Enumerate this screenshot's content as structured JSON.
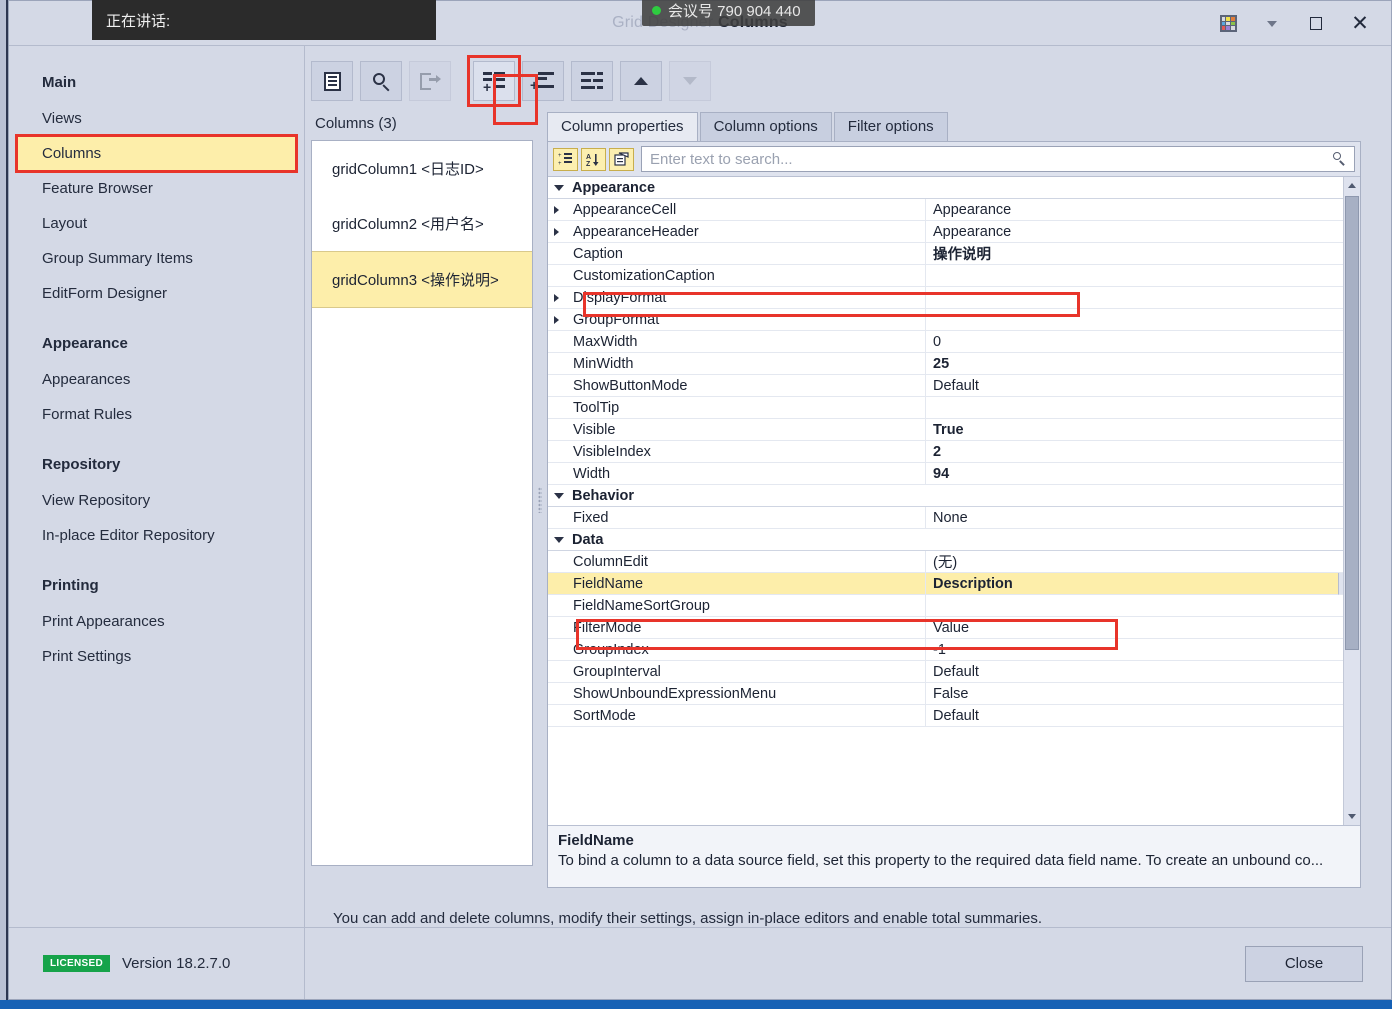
{
  "window": {
    "title_dim": "Grid Designer",
    "title_strong": "Columns",
    "buttons": {
      "grid_icon": "color-grid-icon",
      "dropdown_icon": "chevron-down-icon",
      "restore_label": "❐",
      "close_label": "✕"
    }
  },
  "overlays": {
    "speaking": "正在讲话:",
    "meeting": "会议号 790 904 440"
  },
  "sidebar": {
    "groups": [
      {
        "title": "Main",
        "items": [
          "Views",
          "Columns",
          "Feature Browser",
          "Layout",
          "Group Summary Items",
          "EditForm Designer"
        ]
      },
      {
        "title": "Appearance",
        "items": [
          "Appearances",
          "Format Rules"
        ]
      },
      {
        "title": "Repository",
        "items": [
          "View Repository",
          "In-place Editor Repository"
        ]
      },
      {
        "title": "Printing",
        "items": [
          "Print Appearances",
          "Print Settings"
        ]
      }
    ],
    "selected": "Columns",
    "footer": {
      "badge": "LICENSED",
      "version": "Version 18.2.7.0"
    }
  },
  "toolbar": {
    "buttons": [
      {
        "name": "show-designer-button",
        "icon": "document-icon",
        "disabled": false,
        "highlighted": false
      },
      {
        "name": "find-button",
        "icon": "search-icon",
        "disabled": false,
        "highlighted": false
      },
      {
        "name": "retrieve-fields-button",
        "icon": "export-icon",
        "disabled": true,
        "highlighted": false
      },
      {
        "name": "add-column-button",
        "icon": "add-list-item-icon",
        "disabled": false,
        "highlighted": true
      },
      {
        "name": "add-banded-column-button",
        "icon": "add-list-item-alt-icon",
        "disabled": false,
        "highlighted": false
      },
      {
        "name": "delete-column-button",
        "icon": "remove-list-item-icon",
        "disabled": false,
        "highlighted": false
      },
      {
        "name": "move-up-button",
        "icon": "chevron-up-icon",
        "disabled": false,
        "highlighted": false
      },
      {
        "name": "move-down-button",
        "icon": "chevron-down-icon",
        "disabled": true,
        "highlighted": false
      }
    ]
  },
  "columns_pane": {
    "title": "Columns (3)",
    "items": [
      {
        "label": "gridColumn1 <日志ID>",
        "selected": false
      },
      {
        "label": "gridColumn2 <用户名>",
        "selected": false
      },
      {
        "label": "gridColumn3 <操作说明>",
        "selected": true
      }
    ]
  },
  "property_pane": {
    "tabs": [
      {
        "label": "Column properties",
        "active": true
      },
      {
        "label": "Column options",
        "active": false
      },
      {
        "label": "Filter options",
        "active": false
      }
    ],
    "search": {
      "placeholder": "Enter text to search...",
      "value": "",
      "buttons": [
        {
          "name": "categorized-view-button",
          "glyph": "categorized-icon"
        },
        {
          "name": "alphabetical-sort-button",
          "glyph": "sort-az-icon"
        },
        {
          "name": "property-pages-button",
          "glyph": "property-pages-icon"
        }
      ]
    },
    "rows": [
      {
        "type": "category",
        "name": "Appearance"
      },
      {
        "type": "prop",
        "expandable": true,
        "name": "AppearanceCell",
        "value": "Appearance",
        "bold": false
      },
      {
        "type": "prop",
        "expandable": true,
        "name": "AppearanceHeader",
        "value": "Appearance",
        "bold": false
      },
      {
        "type": "prop",
        "expandable": false,
        "name": "Caption",
        "value": "操作说明",
        "bold": true
      },
      {
        "type": "prop",
        "expandable": false,
        "name": "CustomizationCaption",
        "value": "",
        "bold": false
      },
      {
        "type": "prop",
        "expandable": true,
        "name": "DisplayFormat",
        "value": "",
        "bold": false
      },
      {
        "type": "prop",
        "expandable": true,
        "name": "GroupFormat",
        "value": "",
        "bold": false
      },
      {
        "type": "prop",
        "expandable": false,
        "name": "MaxWidth",
        "value": "0",
        "bold": false
      },
      {
        "type": "prop",
        "expandable": false,
        "name": "MinWidth",
        "value": "25",
        "bold": true
      },
      {
        "type": "prop",
        "expandable": false,
        "name": "ShowButtonMode",
        "value": "Default",
        "bold": false
      },
      {
        "type": "prop",
        "expandable": false,
        "name": "ToolTip",
        "value": "",
        "bold": false
      },
      {
        "type": "prop",
        "expandable": false,
        "name": "Visible",
        "value": "True",
        "bold": true
      },
      {
        "type": "prop",
        "expandable": false,
        "name": "VisibleIndex",
        "value": "2",
        "bold": true
      },
      {
        "type": "prop",
        "expandable": false,
        "name": "Width",
        "value": "94",
        "bold": true
      },
      {
        "type": "category",
        "name": "Behavior"
      },
      {
        "type": "prop",
        "expandable": false,
        "name": "Fixed",
        "value": "None",
        "bold": false
      },
      {
        "type": "category",
        "name": "Data"
      },
      {
        "type": "prop",
        "expandable": false,
        "name": "ColumnEdit",
        "value": "(无)",
        "bold": false
      },
      {
        "type": "prop",
        "expandable": false,
        "name": "FieldName",
        "value": "Description",
        "bold": true,
        "selected": true,
        "dropdown": true
      },
      {
        "type": "prop",
        "expandable": false,
        "name": "FieldNameSortGroup",
        "value": "",
        "bold": false
      },
      {
        "type": "prop",
        "expandable": false,
        "name": "FilterMode",
        "value": "Value",
        "bold": false
      },
      {
        "type": "prop",
        "expandable": false,
        "name": "GroupIndex",
        "value": "-1",
        "bold": false
      },
      {
        "type": "prop",
        "expandable": false,
        "name": "GroupInterval",
        "value": "Default",
        "bold": false
      },
      {
        "type": "prop",
        "expandable": false,
        "name": "ShowUnboundExpressionMenu",
        "value": "False",
        "bold": false
      },
      {
        "type": "prop",
        "expandable": false,
        "name": "SortMode",
        "value": "Default",
        "bold": false
      }
    ],
    "description": {
      "title": "FieldName",
      "body": "To bind a column to a data source field, set this property to the required data field name. To create an unbound co..."
    }
  },
  "hint_text": "You can add and delete columns, modify their settings, assign in-place editors and enable total summaries.",
  "footer": {
    "close_label": "Close"
  },
  "colors": {
    "background": "#d4d9e6",
    "accent_highlight": "#fdeeaa",
    "annotation_red": "#e8342a",
    "licensed_green": "#16a34a"
  }
}
